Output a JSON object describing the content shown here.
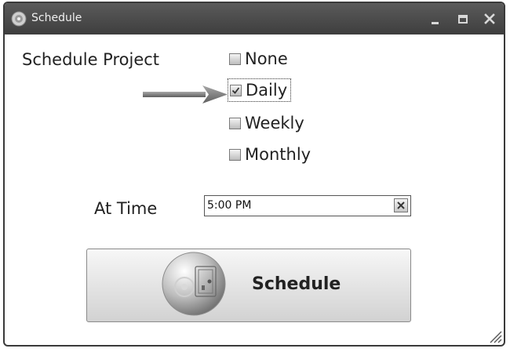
{
  "window": {
    "title": "Schedule"
  },
  "form": {
    "schedule_project_label": "Schedule Project",
    "options": [
      {
        "label": "None",
        "checked": false
      },
      {
        "label": "Daily",
        "checked": true
      },
      {
        "label": "Weekly",
        "checked": false
      },
      {
        "label": "Monthly",
        "checked": false
      }
    ],
    "at_time_label": "At Time",
    "time_value": "5:00 PM"
  },
  "button": {
    "label": "Schedule"
  },
  "icons": {
    "app": "disc-icon",
    "minimize": "minimize-icon",
    "maximize": "maximize-icon",
    "close": "close-icon",
    "arrow": "arrow-right-icon",
    "clear": "clear-x-icon",
    "button": "safe-disc-icon",
    "resize": "resize-grip-icon"
  },
  "colors": {
    "titlebar": "#4a4a4a",
    "arrow": "#7f7f7f",
    "button_bg": "#e0e0e0"
  }
}
